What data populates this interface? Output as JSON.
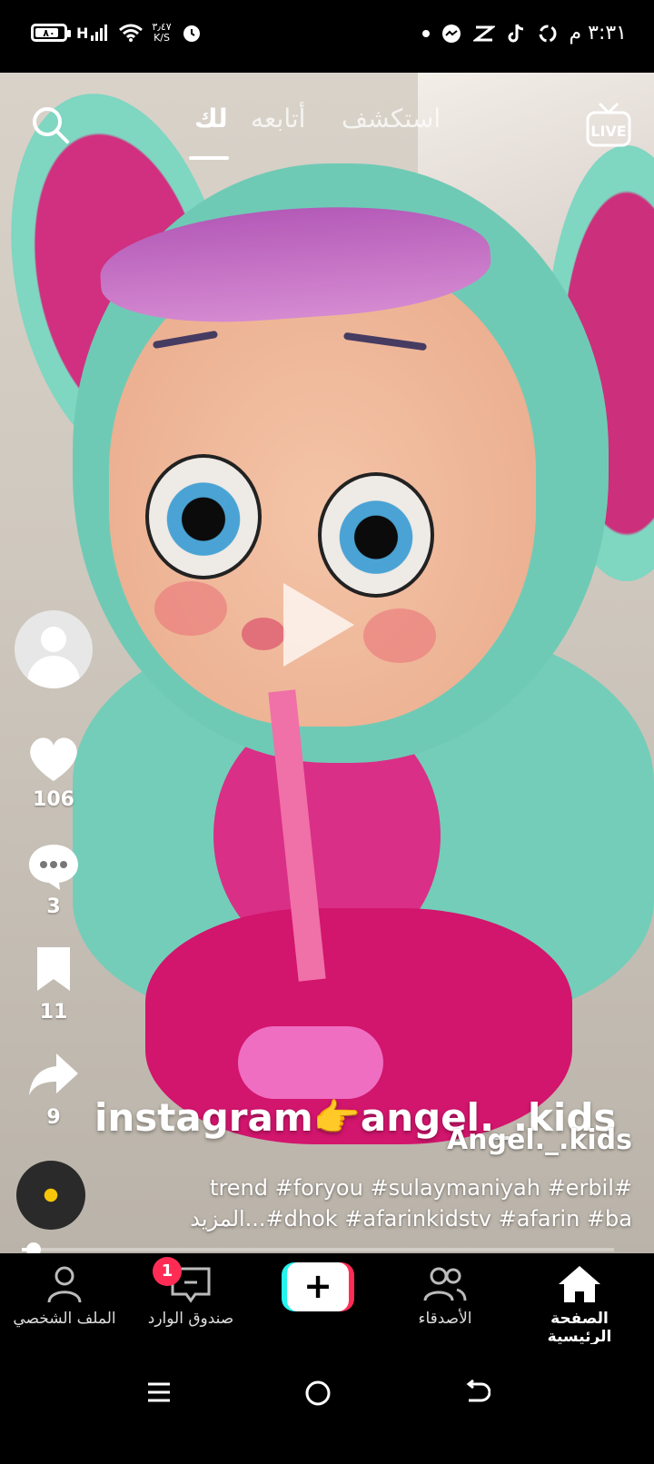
{
  "status_bar": {
    "time": "٣:٣١ م",
    "battery": "٨٠",
    "battery_level": 0.8,
    "network": "H",
    "speed_value": "٣٫٤٧",
    "speed_unit": "K/S"
  },
  "top_nav": {
    "tabs": [
      "استكشف",
      "أتابعه",
      "لك"
    ],
    "active_tab": "لك",
    "live_label": "LIVE"
  },
  "video": {
    "overlay_text": "instagram👉angel._.kids",
    "progress": 0.02
  },
  "side_rail": {
    "likes": "106",
    "comments": "3",
    "saves": "11",
    "shares": "9"
  },
  "post": {
    "username": "Angel._.kids",
    "caption_line1": "trend #foryou #sulaymaniyah #erbil#",
    "caption_line2": "المزيد...#dhok #afarinkidstv #afarin #ba"
  },
  "bottom_nav": {
    "items": [
      {
        "label": "الصفحة الرئيسية",
        "icon": "home-icon"
      },
      {
        "label": "الأصدقاء",
        "icon": "friends-icon"
      },
      {
        "label": "",
        "icon": "plus-icon"
      },
      {
        "label": "صندوق الوارد",
        "icon": "inbox-icon"
      },
      {
        "label": "الملف الشخصي",
        "icon": "profile-icon"
      }
    ],
    "inbox_badge": "1"
  },
  "colors": {
    "accent_red": "#fe2c55",
    "accent_cyan": "#25f4ee",
    "disc_yellow": "#f6c60b"
  }
}
